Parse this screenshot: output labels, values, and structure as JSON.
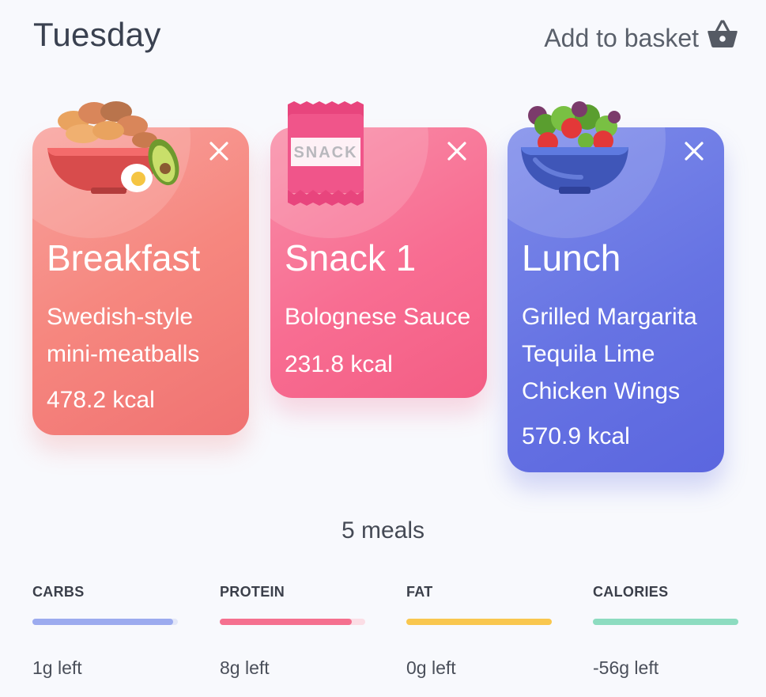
{
  "header": {
    "day": "Tuesday",
    "basket_label": "Add to basket",
    "basket_icon": "basket-icon"
  },
  "meals": [
    {
      "name": "Breakfast",
      "recipe": "Swedish-style mini-meatballs",
      "kcal": "478.2 kcal",
      "color": "#f6877f",
      "icon": "breakfast-bowl-icon"
    },
    {
      "name": "Snack 1",
      "recipe": "Bolognese Sauce",
      "kcal": "231.8 kcal",
      "color": "#f86d92",
      "icon": "snack-bar-icon",
      "icon_text": "SNACK"
    },
    {
      "name": "Lunch",
      "recipe": "Grilled Margarita Tequila Lime Chicken Wings",
      "kcal": "570.9 kcal",
      "color": "#6673e3",
      "icon": "salad-bowl-icon"
    }
  ],
  "summary": {
    "meals_count": "5 meals"
  },
  "macros": [
    {
      "label": "CARBS",
      "left": "1g left",
      "progress": 0.97,
      "color": "#9cabef",
      "track": "#e3e7f8"
    },
    {
      "label": "PROTEIN",
      "left": "8g left",
      "progress": 0.91,
      "color": "#f5708f",
      "track": "#fbdde5"
    },
    {
      "label": "FAT",
      "left": "0g left",
      "progress": 1.0,
      "color": "#f9c74f",
      "track": "#fdf0cf"
    },
    {
      "label": "CALORIES",
      "left": "-56g left",
      "progress": 1.0,
      "color": "#8ddcc0",
      "track": "#d8f4ea"
    }
  ]
}
